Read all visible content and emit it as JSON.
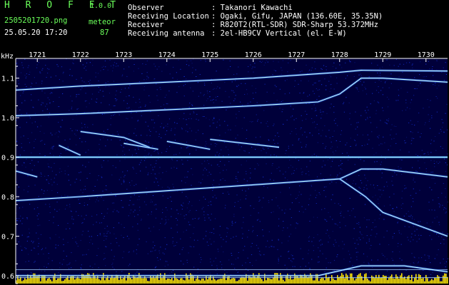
{
  "header": {
    "logo": "H R O F F T",
    "version": "1.0.0",
    "filename": "2505201720.png",
    "timestamp": "25.05.20 17:20",
    "meteor_label": "meteor",
    "meteor_count": "87",
    "info_rows": [
      {
        "label": "Observer",
        "value": ": Takanori Kawachi"
      },
      {
        "label": "Receiving Location",
        "value": ": Ogaki, Gifu, JAPAN (136.60E, 35.35N)"
      },
      {
        "label": "Receiver",
        "value": ": R820T2(RTL-SDR) SDR-Sharp 53.372MHz"
      },
      {
        "label": "Receiving antenna",
        "value": ": 2el-HB9CV Vertical (el. E-W)"
      }
    ]
  },
  "chart_data": {
    "type": "heatmap",
    "ylabel": "kHz",
    "x_ticks": [
      "1721",
      "1722",
      "1723",
      "1724",
      "1725",
      "1726",
      "1727",
      "1728",
      "1729",
      "1730"
    ],
    "y_ticks": [
      "1.1",
      "1.0",
      "0.9",
      "0.8",
      "0.7",
      "0.6"
    ],
    "xlim": [
      1720.5,
      1730.5
    ],
    "ylim": [
      0.58,
      1.15
    ],
    "grid": false,
    "colors": {
      "background": "#00003a",
      "noise": "#1a3cff",
      "signal": "#c8ffff",
      "axis": "#ffffff",
      "bar": "#ffe500"
    },
    "traces": [
      {
        "points": [
          [
            1720.5,
            1.07
          ],
          [
            1722,
            1.08
          ],
          [
            1724,
            1.09
          ],
          [
            1726,
            1.1
          ],
          [
            1728,
            1.115
          ],
          [
            1728.5,
            1.12
          ],
          [
            1730.5,
            1.118
          ]
        ]
      },
      {
        "points": [
          [
            1720.5,
            1.005
          ],
          [
            1722,
            1.01
          ],
          [
            1724,
            1.02
          ],
          [
            1726,
            1.03
          ],
          [
            1727.5,
            1.04
          ],
          [
            1728,
            1.06
          ],
          [
            1728.5,
            1.1
          ],
          [
            1729,
            1.1
          ],
          [
            1730.5,
            1.09
          ]
        ]
      },
      {
        "points": [
          [
            1720.5,
            0.79
          ],
          [
            1722,
            0.8
          ],
          [
            1724,
            0.815
          ],
          [
            1726,
            0.83
          ],
          [
            1728,
            0.845
          ],
          [
            1728.5,
            0.87
          ],
          [
            1729,
            0.87
          ],
          [
            1730.5,
            0.85
          ]
        ]
      },
      {
        "points": [
          [
            1728,
            0.845
          ],
          [
            1728.6,
            0.8
          ],
          [
            1729,
            0.76
          ],
          [
            1730.5,
            0.7
          ]
        ]
      },
      {
        "points": [
          [
            1720.5,
            0.6
          ],
          [
            1727.5,
            0.6
          ],
          [
            1728.5,
            0.625
          ],
          [
            1729.5,
            0.625
          ],
          [
            1730.5,
            0.61
          ]
        ]
      },
      {
        "points": [
          [
            1720.5,
            0.865
          ],
          [
            1721,
            0.85
          ]
        ]
      },
      {
        "points": [
          [
            1721.5,
            0.93
          ],
          [
            1722,
            0.905
          ]
        ]
      },
      {
        "points": [
          [
            1722,
            0.965
          ],
          [
            1723,
            0.95
          ],
          [
            1723.6,
            0.925
          ]
        ]
      },
      {
        "points": [
          [
            1723,
            0.935
          ],
          [
            1723.8,
            0.92
          ]
        ]
      },
      {
        "points": [
          [
            1724,
            0.94
          ],
          [
            1725,
            0.92
          ]
        ]
      },
      {
        "points": [
          [
            1725,
            0.945
          ],
          [
            1726.6,
            0.925
          ]
        ]
      }
    ],
    "carrier_khz": 0.9,
    "reference_lines_khz": [
      0.615,
      0.595
    ]
  }
}
